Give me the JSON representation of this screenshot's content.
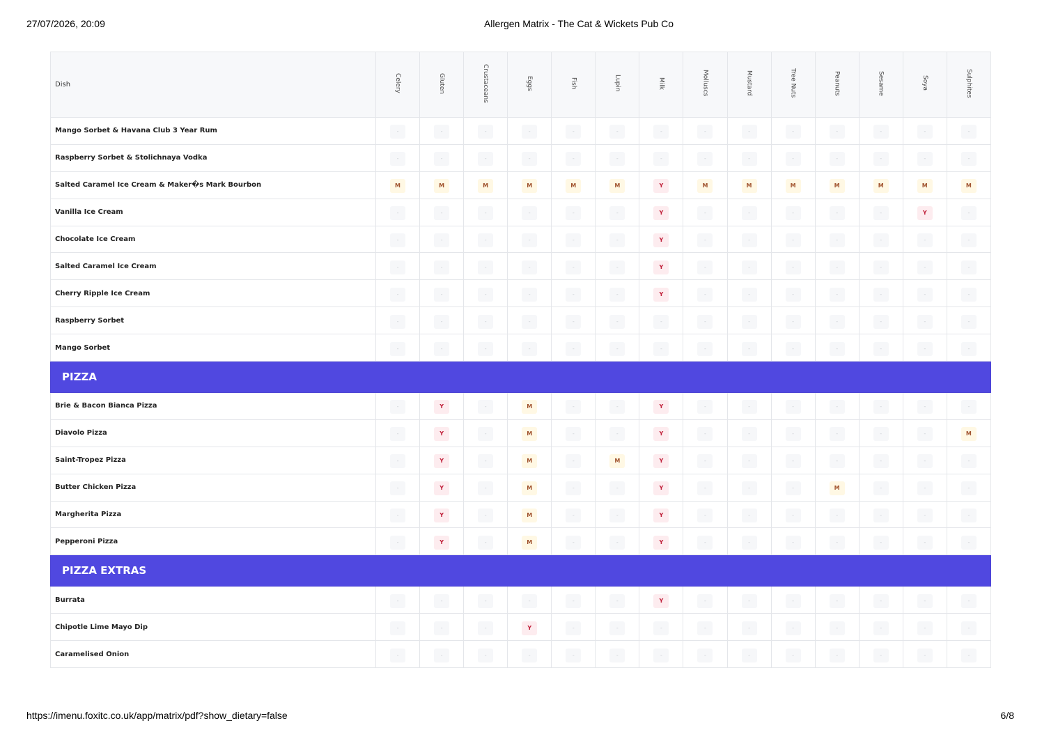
{
  "print_header": {
    "datetime": "27/07/2026, 20:09",
    "title": "Allergen Matrix - The Cat & Wickets Pub Co"
  },
  "print_footer": {
    "url": "https://imenu.foxitc.co.uk/app/matrix/pdf?show_dietary=false",
    "page": "6/8"
  },
  "colors": {
    "section_band": "#5048e0",
    "may_contain_bg": "#fff8e4",
    "may_contain_text": "#a0522d",
    "contains_bg": "#fdecef",
    "contains_text": "#c0203a",
    "none_bg": "#f6f7f9"
  },
  "matrix": {
    "dish_header": "Dish",
    "allergens": [
      "Celery",
      "Gluten",
      "Crustaceans",
      "Eggs",
      "Fish",
      "Lupin",
      "Milk",
      "Molluscs",
      "Mustard",
      "Tree Nuts",
      "Peanuts",
      "Sesame",
      "Soya",
      "Sulphites"
    ],
    "rows": [
      {
        "dish": "Mango Sorbet & Havana Club 3 Year Rum",
        "values": [
          "-",
          "-",
          "-",
          "-",
          "-",
          "-",
          "-",
          "-",
          "-",
          "-",
          "-",
          "-",
          "-",
          "-"
        ]
      },
      {
        "dish": "Raspberry Sorbet & Stolichnaya Vodka",
        "values": [
          "-",
          "-",
          "-",
          "-",
          "-",
          "-",
          "-",
          "-",
          "-",
          "-",
          "-",
          "-",
          "-",
          "-"
        ]
      },
      {
        "dish": "Salted Caramel Ice Cream & Maker�s Mark Bourbon",
        "values": [
          "M",
          "M",
          "M",
          "M",
          "M",
          "M",
          "Y",
          "M",
          "M",
          "M",
          "M",
          "M",
          "M",
          "M"
        ]
      },
      {
        "dish": "Vanilla Ice Cream",
        "values": [
          "-",
          "-",
          "-",
          "-",
          "-",
          "-",
          "Y",
          "-",
          "-",
          "-",
          "-",
          "-",
          "Y",
          "-"
        ]
      },
      {
        "dish": "Chocolate Ice Cream",
        "values": [
          "-",
          "-",
          "-",
          "-",
          "-",
          "-",
          "Y",
          "-",
          "-",
          "-",
          "-",
          "-",
          "-",
          "-"
        ]
      },
      {
        "dish": "Salted Caramel Ice Cream",
        "values": [
          "-",
          "-",
          "-",
          "-",
          "-",
          "-",
          "Y",
          "-",
          "-",
          "-",
          "-",
          "-",
          "-",
          "-"
        ]
      },
      {
        "dish": "Cherry Ripple Ice Cream",
        "values": [
          "-",
          "-",
          "-",
          "-",
          "-",
          "-",
          "Y",
          "-",
          "-",
          "-",
          "-",
          "-",
          "-",
          "-"
        ]
      },
      {
        "dish": "Raspberry Sorbet",
        "values": [
          "-",
          "-",
          "-",
          "-",
          "-",
          "-",
          "-",
          "-",
          "-",
          "-",
          "-",
          "-",
          "-",
          "-"
        ]
      },
      {
        "dish": "Mango Sorbet",
        "values": [
          "-",
          "-",
          "-",
          "-",
          "-",
          "-",
          "-",
          "-",
          "-",
          "-",
          "-",
          "-",
          "-",
          "-"
        ]
      },
      {
        "section": "PIZZA"
      },
      {
        "dish": "Brie & Bacon Bianca Pizza",
        "values": [
          "-",
          "Y",
          "-",
          "M",
          "-",
          "-",
          "Y",
          "-",
          "-",
          "-",
          "-",
          "-",
          "-",
          "-"
        ]
      },
      {
        "dish": "Diavolo Pizza",
        "values": [
          "-",
          "Y",
          "-",
          "M",
          "-",
          "-",
          "Y",
          "-",
          "-",
          "-",
          "-",
          "-",
          "-",
          "M"
        ]
      },
      {
        "dish": "Saint-Tropez Pizza",
        "values": [
          "-",
          "Y",
          "-",
          "M",
          "-",
          "M",
          "Y",
          "-",
          "-",
          "-",
          "-",
          "-",
          "-",
          "-"
        ]
      },
      {
        "dish": "Butter Chicken Pizza",
        "values": [
          "-",
          "Y",
          "-",
          "M",
          "-",
          "-",
          "Y",
          "-",
          "-",
          "-",
          "M",
          "-",
          "-",
          "-"
        ]
      },
      {
        "dish": "Margherita Pizza",
        "values": [
          "-",
          "Y",
          "-",
          "M",
          "-",
          "-",
          "Y",
          "-",
          "-",
          "-",
          "-",
          "-",
          "-",
          "-"
        ]
      },
      {
        "dish": "Pepperoni Pizza",
        "values": [
          "-",
          "Y",
          "-",
          "M",
          "-",
          "-",
          "Y",
          "-",
          "-",
          "-",
          "-",
          "-",
          "-",
          "-"
        ]
      },
      {
        "section": "PIZZA EXTRAS"
      },
      {
        "dish": "Burrata",
        "values": [
          "-",
          "-",
          "-",
          "-",
          "-",
          "-",
          "Y",
          "-",
          "-",
          "-",
          "-",
          "-",
          "-",
          "-"
        ]
      },
      {
        "dish": "Chipotle Lime Mayo Dip",
        "values": [
          "-",
          "-",
          "-",
          "Y",
          "-",
          "-",
          "-",
          "-",
          "-",
          "-",
          "-",
          "-",
          "-",
          "-"
        ]
      },
      {
        "dish": "Caramelised Onion",
        "values": [
          "-",
          "-",
          "-",
          "-",
          "-",
          "-",
          "-",
          "-",
          "-",
          "-",
          "-",
          "-",
          "-",
          "-"
        ]
      }
    ]
  }
}
